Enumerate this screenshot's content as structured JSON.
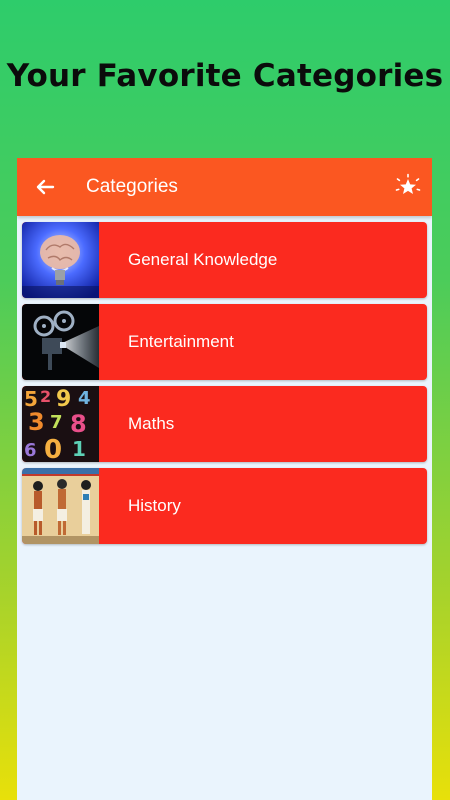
{
  "headline": "Your Favorite Categories",
  "appbar": {
    "title": "Categories",
    "back_icon": "arrow-left-icon",
    "action_icon": "sparkle-star-icon"
  },
  "colors": {
    "appbar": "#fb5721",
    "card": "#fb2a1f",
    "list_background": "#eaf4fd"
  },
  "categories": [
    {
      "label": "General Knowledge",
      "image": "brain-lightbulb-image"
    },
    {
      "label": "Entertainment",
      "image": "film-projector-image"
    },
    {
      "label": "Maths",
      "image": "numbers-image"
    },
    {
      "label": "History",
      "image": "egyptian-art-image"
    }
  ]
}
